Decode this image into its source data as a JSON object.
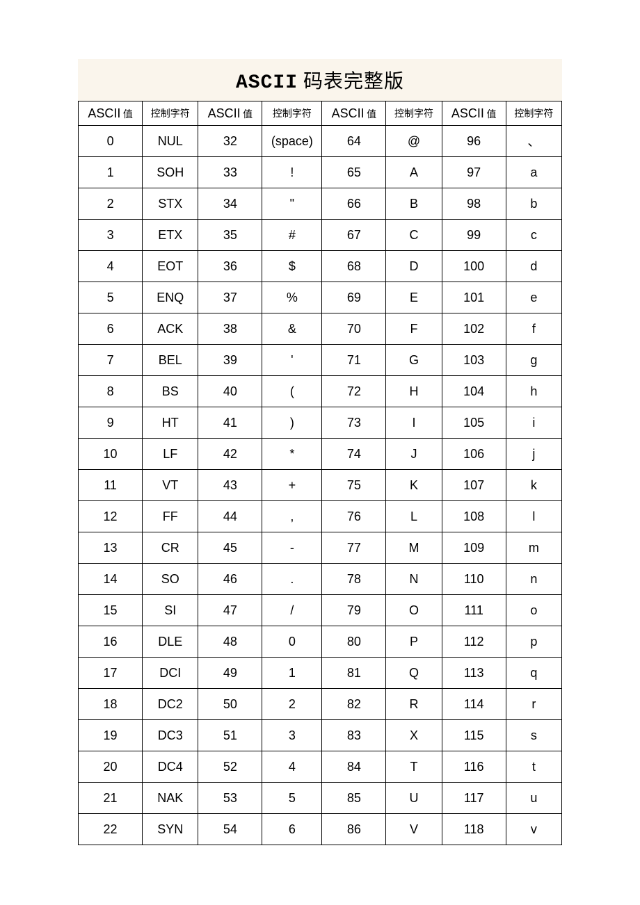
{
  "title_ascii": "ASCII",
  "title_cn": " 码表完整版",
  "header_ascii": "ASCII",
  "header_value_cn": " 值",
  "header_ctrl_cn": "控制字符",
  "rows": [
    {
      "a": "0",
      "b": "NUL",
      "c": "32",
      "d": "(space)",
      "e": "64",
      "f": "@",
      "g": "96",
      "h": "、"
    },
    {
      "a": "1",
      "b": "SOH",
      "c": "33",
      "d": "!",
      "e": "65",
      "f": "A",
      "g": "97",
      "h": "a"
    },
    {
      "a": "2",
      "b": "STX",
      "c": "34",
      "d": "\"",
      "e": "66",
      "f": "B",
      "g": "98",
      "h": "b"
    },
    {
      "a": "3",
      "b": "ETX",
      "c": "35",
      "d": "#",
      "e": "67",
      "f": "C",
      "g": "99",
      "h": "c"
    },
    {
      "a": "4",
      "b": "EOT",
      "c": "36",
      "d": "$",
      "e": "68",
      "f": "D",
      "g": "100",
      "h": "d"
    },
    {
      "a": "5",
      "b": "ENQ",
      "c": "37",
      "d": "%",
      "e": "69",
      "f": "E",
      "g": "101",
      "h": "e"
    },
    {
      "a": "6",
      "b": "ACK",
      "c": "38",
      "d": "&",
      "e": "70",
      "f": "F",
      "g": "102",
      "h": "f"
    },
    {
      "a": "7",
      "b": "BEL",
      "c": "39",
      "d": "'",
      "e": "71",
      "f": "G",
      "g": "103",
      "h": "g"
    },
    {
      "a": "8",
      "b": "BS",
      "c": "40",
      "d": "(",
      "e": "72",
      "f": "H",
      "g": "104",
      "h": "h"
    },
    {
      "a": "9",
      "b": "HT",
      "c": "41",
      "d": ")",
      "e": "73",
      "f": "I",
      "g": "105",
      "h": "i"
    },
    {
      "a": "10",
      "b": "LF",
      "c": "42",
      "d": "*",
      "e": "74",
      "f": "J",
      "g": "106",
      "h": "j"
    },
    {
      "a": "11",
      "b": "VT",
      "c": "43",
      "d": "+",
      "e": "75",
      "f": "K",
      "g": "107",
      "h": "k"
    },
    {
      "a": "12",
      "b": "FF",
      "c": "44",
      "d": ",",
      "e": "76",
      "f": "L",
      "g": "108",
      "h": "l"
    },
    {
      "a": "13",
      "b": "CR",
      "c": "45",
      "d": "-",
      "e": "77",
      "f": "M",
      "g": "109",
      "h": "m"
    },
    {
      "a": "14",
      "b": "SO",
      "c": "46",
      "d": ".",
      "e": "78",
      "f": "N",
      "g": "110",
      "h": "n"
    },
    {
      "a": "15",
      "b": "SI",
      "c": "47",
      "d": "/",
      "e": "79",
      "f": "O",
      "g": "111",
      "h": "o"
    },
    {
      "a": "16",
      "b": "DLE",
      "c": "48",
      "d": "0",
      "e": "80",
      "f": "P",
      "g": "112",
      "h": "p"
    },
    {
      "a": "17",
      "b": "DCI",
      "c": "49",
      "d": "1",
      "e": "81",
      "f": "Q",
      "g": "113",
      "h": "q"
    },
    {
      "a": "18",
      "b": "DC2",
      "c": "50",
      "d": "2",
      "e": "82",
      "f": "R",
      "g": "114",
      "h": "r"
    },
    {
      "a": "19",
      "b": "DC3",
      "c": "51",
      "d": "3",
      "e": "83",
      "f": "X",
      "g": "115",
      "h": "s"
    },
    {
      "a": "20",
      "b": "DC4",
      "c": "52",
      "d": "4",
      "e": "84",
      "f": "T",
      "g": "116",
      "h": "t"
    },
    {
      "a": "21",
      "b": "NAK",
      "c": "53",
      "d": "5",
      "e": "85",
      "f": "U",
      "g": "117",
      "h": "u"
    },
    {
      "a": "22",
      "b": "SYN",
      "c": "54",
      "d": "6",
      "e": "86",
      "f": "V",
      "g": "118",
      "h": "v"
    }
  ]
}
